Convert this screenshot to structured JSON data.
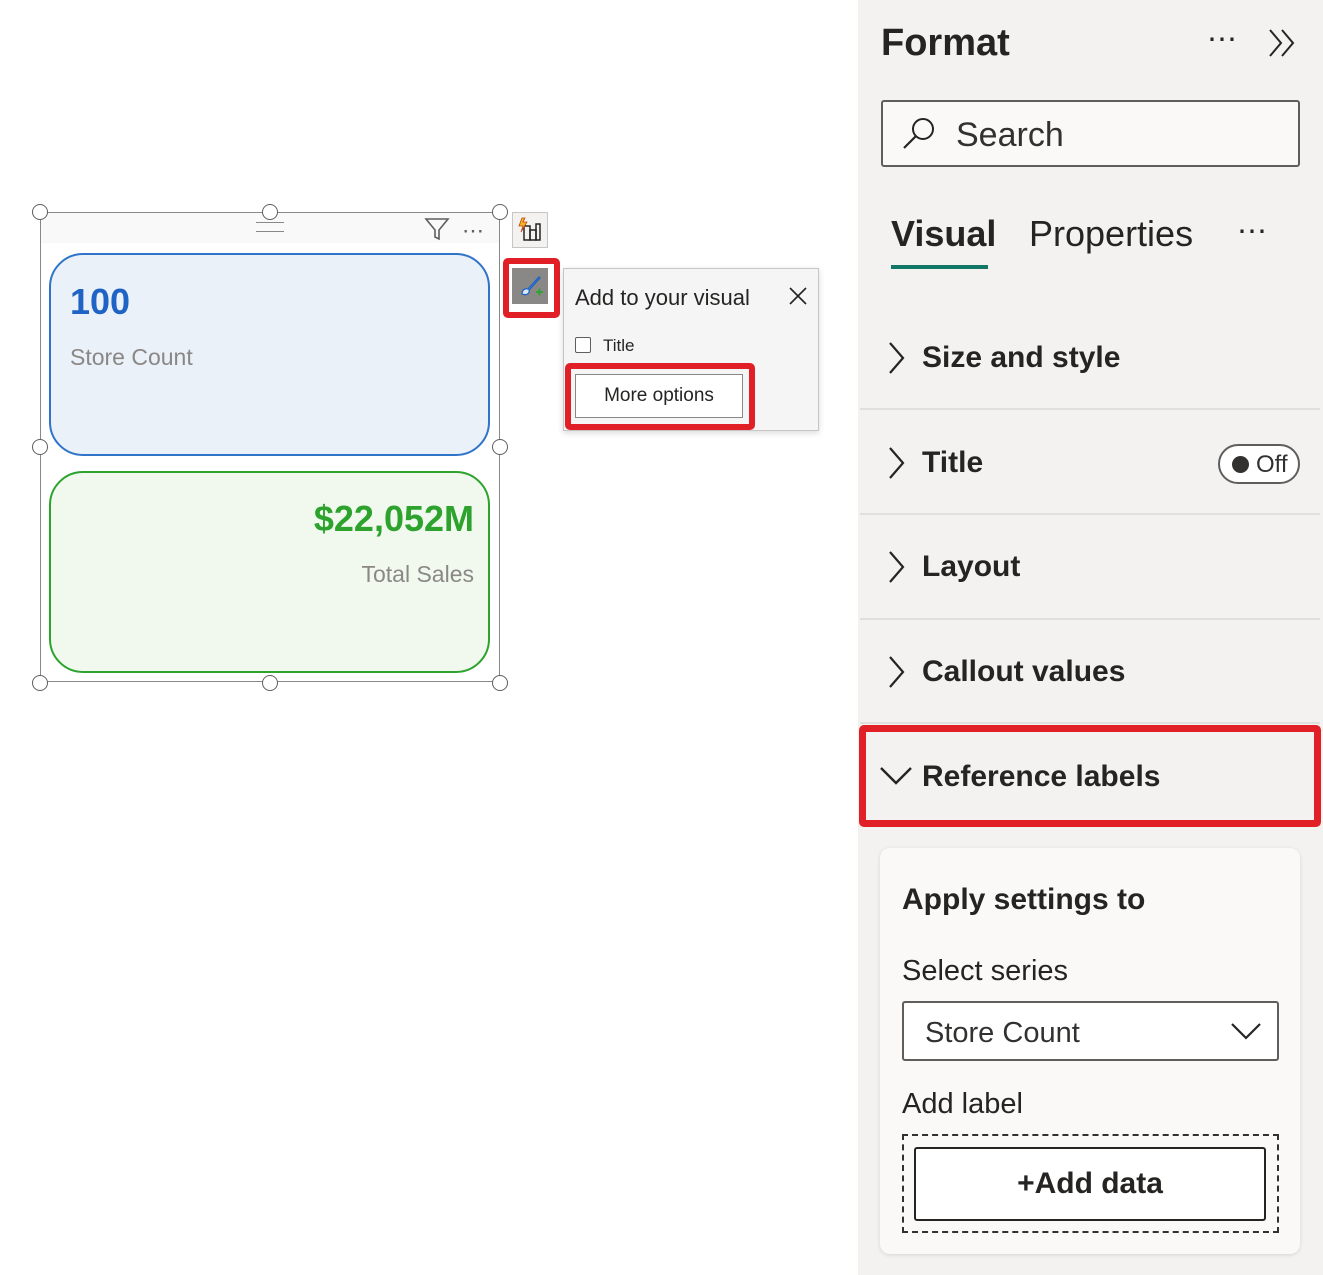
{
  "visual": {
    "cards": [
      {
        "value": "100",
        "label": "Store Count",
        "value_color": "#1f63c4"
      },
      {
        "value": "$22,052M",
        "label": "Total Sales",
        "value_color": "#2da32e"
      }
    ]
  },
  "popup": {
    "title": "Add to your visual",
    "checkbox_label": "Title",
    "more_options_label": "More options"
  },
  "format_pane": {
    "title": "Format",
    "search_placeholder": "Search",
    "tabs": [
      "Visual",
      "Properties"
    ],
    "sections": [
      {
        "label": "Size and style"
      },
      {
        "label": "Title",
        "toggle": "Off"
      },
      {
        "label": "Layout"
      },
      {
        "label": "Callout values"
      },
      {
        "label": "Reference labels",
        "expanded": true
      }
    ],
    "reference_labels": {
      "heading": "Apply settings to",
      "select_series_label": "Select series",
      "select_series_value": "Store Count",
      "add_label_heading": "Add label",
      "add_data_button": "+Add data"
    }
  },
  "colors": {
    "highlight": "#e11f26",
    "tab_underline": "#117865",
    "store_border": "#2f74c9",
    "sales_border": "#2da32e"
  }
}
